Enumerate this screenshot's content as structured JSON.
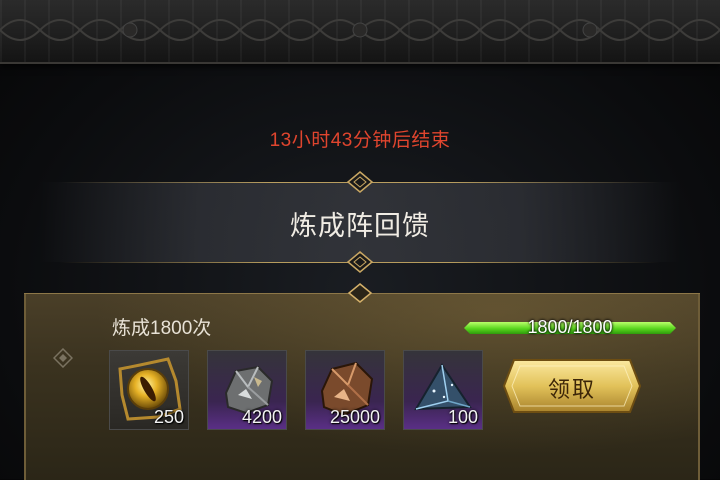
{
  "event": {
    "countdown": "13小时43分钟后结束",
    "title": "炼成阵回馈"
  },
  "reward_tier": {
    "label": "炼成1800次",
    "progress_text": "1800/1800",
    "progress_fraction": 1.0,
    "items": [
      {
        "icon": "golden-eye-orb-icon",
        "count": "250",
        "rarity": "gold"
      },
      {
        "icon": "silver-ore-icon",
        "count": "4200",
        "rarity": "purple"
      },
      {
        "icon": "copper-ore-icon",
        "count": "25000",
        "rarity": "purple"
      },
      {
        "icon": "blue-crystal-shard-icon",
        "count": "100",
        "rarity": "purple"
      }
    ],
    "claim_label": "领取"
  },
  "colors": {
    "countdown": "#e0452e",
    "progress": "#59d61e",
    "button": "#e2c25a"
  }
}
